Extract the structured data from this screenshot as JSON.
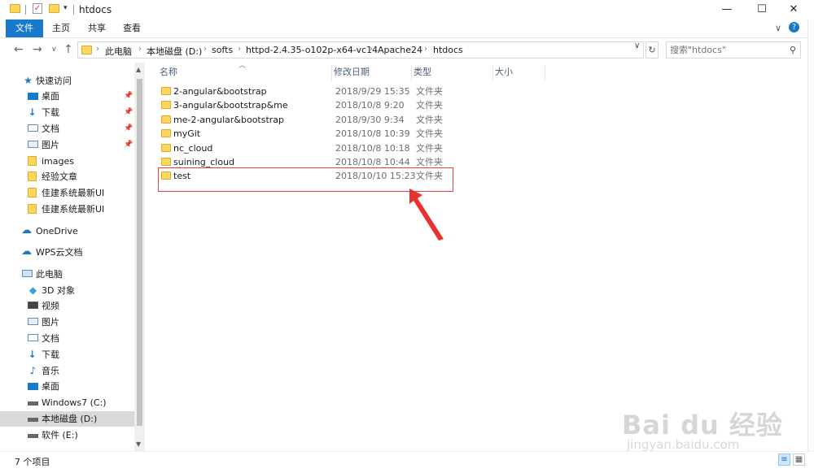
{
  "window": {
    "title": "htdocs",
    "minimize": "—",
    "maximize": "☐",
    "close": "✕"
  },
  "ribbon": {
    "tabs": [
      "文件",
      "主页",
      "共享",
      "查看"
    ],
    "expand": "∨",
    "help": "?"
  },
  "nav_buttons": {
    "back": "←",
    "forward": "→",
    "recent": "∨",
    "up": "↑"
  },
  "breadcrumb": [
    "此电脑",
    "本地磁盘 (D:)",
    "softs",
    "httpd-2.4.35-o102p-x64-vc14",
    "Apache24",
    "htdocs"
  ],
  "address": {
    "separator": "›",
    "dropdown": "∨",
    "refresh": "↻"
  },
  "search": {
    "placeholder": "搜索\"htdocs\""
  },
  "nav_pane": {
    "quick_access": "快速访问",
    "quick_items": [
      {
        "label": "桌面",
        "icon": "desktop-icon",
        "pinned": true
      },
      {
        "label": "下载",
        "icon": "download-icon",
        "pinned": true
      },
      {
        "label": "文档",
        "icon": "document-icon",
        "pinned": true
      },
      {
        "label": "图片",
        "icon": "picture-icon",
        "pinned": true
      },
      {
        "label": "images",
        "icon": "folder-icon",
        "pinned": false
      },
      {
        "label": "经验文章",
        "icon": "folder-icon",
        "pinned": false
      },
      {
        "label": "佳建系统最新UI",
        "icon": "folder-icon",
        "pinned": false
      },
      {
        "label": "佳建系统最新UI",
        "icon": "folder-icon",
        "pinned": false
      }
    ],
    "onedrive": "OneDrive",
    "wps": "WPS云文档",
    "this_pc": "此电脑",
    "pc_items": [
      {
        "label": "3D 对象",
        "icon": "cube-icon"
      },
      {
        "label": "视频",
        "icon": "video-icon"
      },
      {
        "label": "图片",
        "icon": "picture-icon"
      },
      {
        "label": "文档",
        "icon": "document-icon"
      },
      {
        "label": "下载",
        "icon": "download-icon"
      },
      {
        "label": "音乐",
        "icon": "music-icon"
      },
      {
        "label": "桌面",
        "icon": "desktop-icon"
      },
      {
        "label": "Windows7 (C:)",
        "icon": "drive-icon"
      },
      {
        "label": "本地磁盘 (D:)",
        "icon": "drive-icon"
      },
      {
        "label": "软件 (E:)",
        "icon": "drive-icon"
      }
    ]
  },
  "columns": {
    "name": "名称",
    "date": "修改日期",
    "type": "类型",
    "size": "大小"
  },
  "files": [
    {
      "name": "2-angular&bootstrap",
      "date": "2018/9/29 15:35",
      "type": "文件夹"
    },
    {
      "name": "3-angular&bootstrap&me",
      "date": "2018/10/8 9:20",
      "type": "文件夹"
    },
    {
      "name": "me-2-angular&bootstrap",
      "date": "2018/9/30 9:34",
      "type": "文件夹"
    },
    {
      "name": "myGit",
      "date": "2018/10/8 10:39",
      "type": "文件夹"
    },
    {
      "name": "nc_cloud",
      "date": "2018/10/8 10:18",
      "type": "文件夹"
    },
    {
      "name": "suining_cloud",
      "date": "2018/10/8 10:44",
      "type": "文件夹"
    },
    {
      "name": "test",
      "date": "2018/10/10 15:23",
      "type": "文件夹"
    }
  ],
  "status": {
    "count": "7 个项目"
  },
  "colors": {
    "accent": "#1979ca",
    "folder": "#ffd65c",
    "annotation": "#e43f3f",
    "selection": "#cce8ff"
  },
  "watermark": {
    "brand": "Bai du 经验",
    "url": "jingyan.baidu.com"
  }
}
